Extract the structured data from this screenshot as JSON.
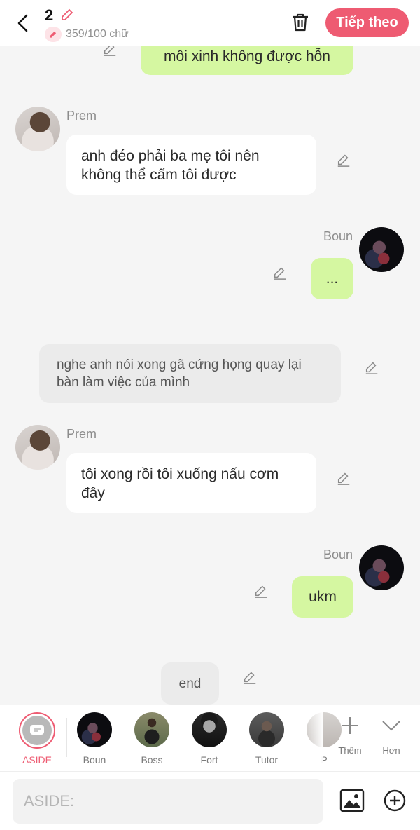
{
  "header": {
    "chapter_number": "2",
    "word_count": "359/100 chữ",
    "next_label": "Tiếp theo"
  },
  "messages": [
    {
      "type": "self",
      "sender": "",
      "text": "môi xinh không được hỗn"
    },
    {
      "type": "left",
      "sender": "Prem",
      "text": "anh đéo phải ba mẹ tôi nên không thể cấm tôi được"
    },
    {
      "type": "right",
      "sender": "Boun",
      "text": "..."
    },
    {
      "type": "aside",
      "sender": "",
      "text": "nghe anh nói xong gã cứng họng quay lại bàn làm việc của mình"
    },
    {
      "type": "left",
      "sender": "Prem",
      "text": "tôi xong rồi tôi xuống nấu cơm đây"
    },
    {
      "type": "right",
      "sender": "Boun",
      "text": "ukm"
    },
    {
      "type": "aside",
      "sender": "",
      "text": "end"
    }
  ],
  "characters": {
    "aside": "ASIDE",
    "items": [
      "Boun",
      "Boss",
      "Fort",
      "Tutor",
      "P"
    ],
    "add_label": "Thêm",
    "more_label": "Hơn"
  },
  "input": {
    "placeholder": "ASIDE:"
  },
  "colors": {
    "accent": "#ee5b72",
    "self_bubble": "#d5f7a1",
    "other_bubble": "#ffffff",
    "aside_bubble": "#ebebeb"
  }
}
